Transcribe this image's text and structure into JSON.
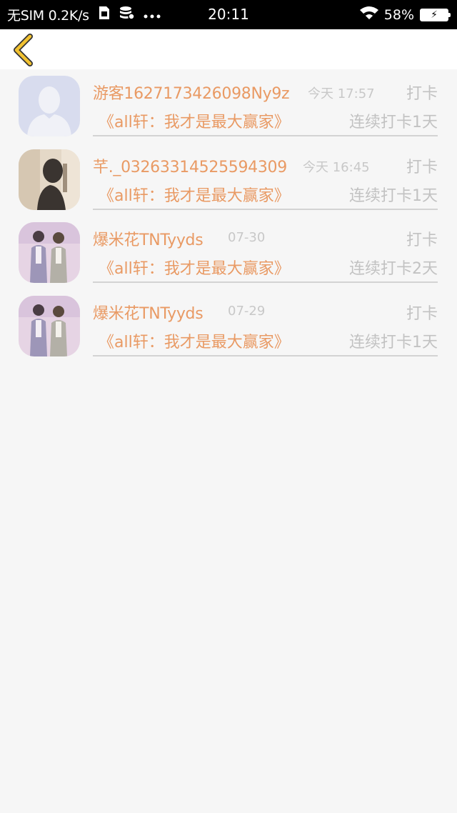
{
  "status_bar": {
    "carrier": "无SIM 0.2K/s",
    "time": "20:11",
    "battery": "58%",
    "icons": [
      "sim-card-icon",
      "data-saver-icon",
      "more-dots-icon",
      "wifi-icon",
      "battery-charging-icon"
    ]
  },
  "nav": {
    "back_icon": "chevron-left-icon",
    "accent_color": "#f2c231"
  },
  "records": [
    {
      "username": "游客1627173426098Ny9z",
      "time": "今天 17:57",
      "type": "打卡",
      "title": "《all轩：我才是最大赢家》",
      "streak": "连续打卡1天",
      "avatar": "default-user-avatar"
    },
    {
      "username": "芊._03263314525594309",
      "time": "今天 16:45",
      "type": "打卡",
      "title": "《all轩：我才是最大赢家》",
      "streak": "连续打卡1天",
      "avatar": "silhouette-photo-avatar"
    },
    {
      "username": "爆米花TNTyyds",
      "time": "07-30",
      "type": "打卡",
      "title": "《all轩：我才是最大赢家》",
      "streak": "连续打卡2天",
      "avatar": "two-people-photo-avatar"
    },
    {
      "username": "爆米花TNTyyds",
      "time": "07-29",
      "type": "打卡",
      "title": "《all轩：我才是最大赢家》",
      "streak": "连续打卡1天",
      "avatar": "two-people-photo-avatar"
    }
  ],
  "colors": {
    "name_accent": "#e99a64",
    "muted_text": "#c2c2c2",
    "divider": "#d3d3d3",
    "background": "#f6f6f6"
  }
}
